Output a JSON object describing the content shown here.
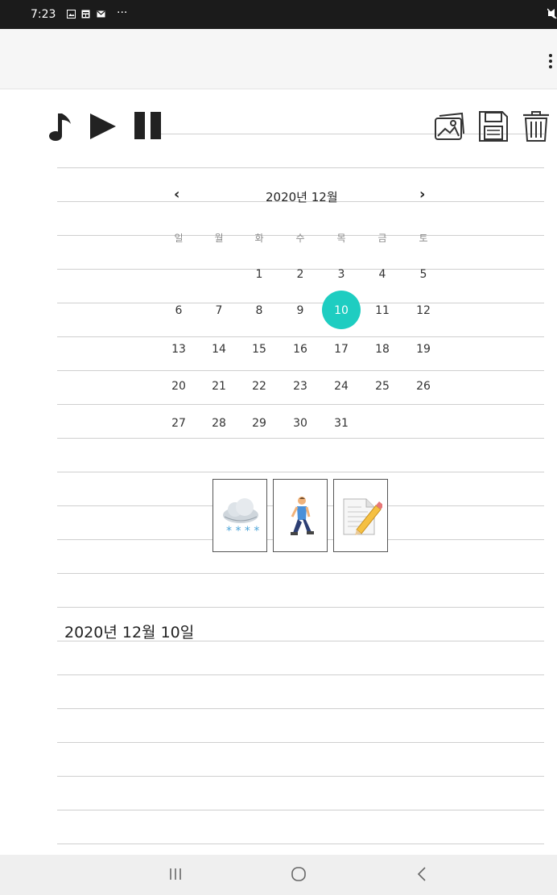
{
  "status_bar": {
    "time": "7:23",
    "more_indicator": "···",
    "notification_icons": [
      "image-icon",
      "app-notification-icon",
      "mail-icon"
    ],
    "right_icons": [
      "mute-icon"
    ]
  },
  "app_bar": {
    "menu_icon": "more-vertical-icon"
  },
  "toolbar": {
    "left_icons": [
      "music-note-icon",
      "play-icon",
      "pause-icon"
    ],
    "right_icons": [
      "image-gallery-icon",
      "save-icon",
      "trash-icon"
    ]
  },
  "calendar": {
    "month_label": "2020년 12월",
    "prev_icon": "‹",
    "next_icon": "›",
    "weekdays": [
      "일",
      "월",
      "화",
      "수",
      "목",
      "금",
      "토"
    ],
    "weeks": [
      [
        "",
        "",
        "1",
        "2",
        "3",
        "4",
        "5"
      ],
      [
        "6",
        "7",
        "8",
        "9",
        "10",
        "11",
        "12"
      ],
      [
        "13",
        "14",
        "15",
        "16",
        "17",
        "18",
        "19"
      ],
      [
        "20",
        "21",
        "22",
        "23",
        "24",
        "25",
        "26"
      ],
      [
        "27",
        "28",
        "29",
        "30",
        "31",
        "",
        ""
      ]
    ],
    "selected_day": "10",
    "accent_color": "#1ecdc1"
  },
  "tiles": [
    {
      "icon": "snow-cloud-icon"
    },
    {
      "icon": "walking-person-icon"
    },
    {
      "icon": "memo-pencil-icon"
    }
  ],
  "diary": {
    "date": "2020년 12월 10일"
  },
  "nav_bar": {
    "recent": "|||",
    "home": "◯",
    "back": "<"
  }
}
